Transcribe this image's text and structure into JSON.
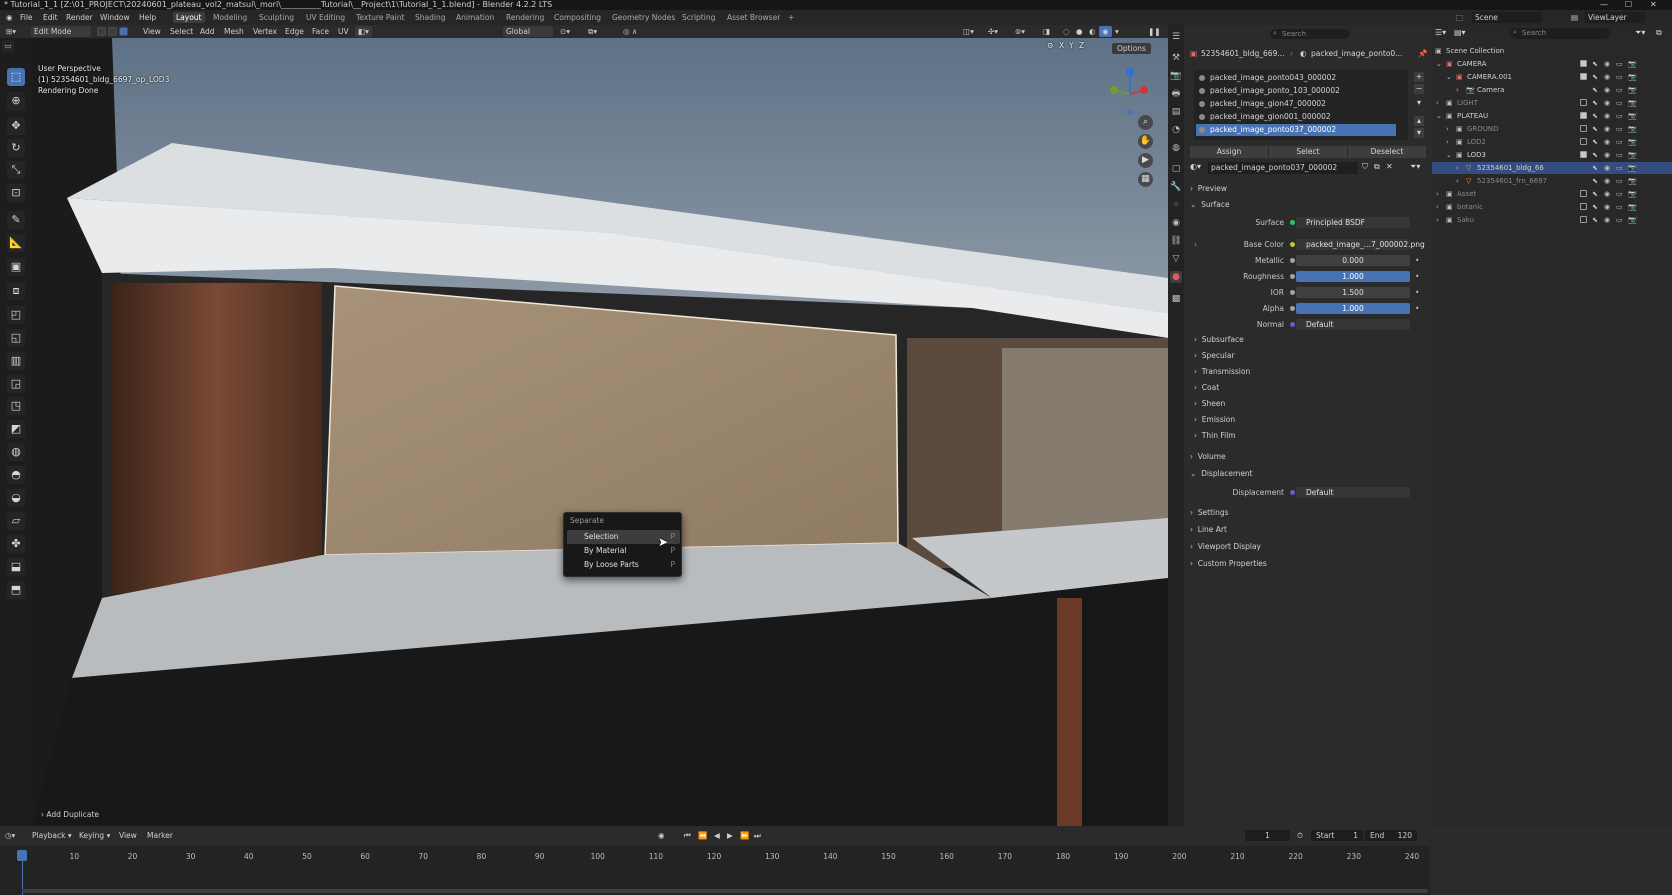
{
  "title_bar": {
    "text": "* Tutorial_1_1 [Z:\\01_PROJECT\\20240601_plateau_vol2_matsui\\_mori\\__________Tutorial\\__Project\\1\\Tutorial_1_1.blend] - Blender 4.2.2 LTS"
  },
  "menu": {
    "items": [
      "File",
      "Edit",
      "Render",
      "Window",
      "Help"
    ]
  },
  "workspaces": [
    "Layout",
    "Modeling",
    "Sculpting",
    "UV Editing",
    "Texture Paint",
    "Shading",
    "Animation",
    "Rendering",
    "Compositing",
    "Geometry Nodes",
    "Scripting",
    "Asset Browser"
  ],
  "scene": {
    "name": "Scene",
    "view_layer": "ViewLayer",
    "search_placeholder": "Search"
  },
  "viewport_header": {
    "mode": "Edit Mode",
    "menus": [
      "View",
      "Select",
      "Add",
      "Mesh",
      "Vertex",
      "Edge",
      "Face",
      "UV"
    ],
    "orientation": "Global",
    "options_label": "Options",
    "axes": [
      "X",
      "Y",
      "Z"
    ]
  },
  "viewport": {
    "overlay_line1": "User Perspective",
    "overlay_line2": "(1) 52354601_bldg_6697_op_LOD3",
    "overlay_line3": "Rendering Done",
    "operator_panel": "Add Duplicate"
  },
  "context_menu": {
    "title": "Separate",
    "items": [
      {
        "label": "Selection",
        "shortcut": "P"
      },
      {
        "label": "By Material",
        "shortcut": "P"
      },
      {
        "label": "By Loose Parts",
        "shortcut": "P"
      }
    ]
  },
  "properties": {
    "breadcrumb": [
      "52354601_bldg_669...",
      "packed_image_ponto0..."
    ],
    "material_slots": [
      "packed_image_ponto043_000002",
      "packed_image_ponto_103_000002",
      "packed_image_gion47_000002",
      "packed_image_gion001_000002",
      "packed_image_ponto037_000002"
    ],
    "slot_buttons": {
      "assign": "Assign",
      "select": "Select",
      "deselect": "Deselect"
    },
    "material_name": "packed_image_ponto037_000002",
    "sections": {
      "preview": "Preview",
      "surface": "Surface",
      "volume": "Volume",
      "displacement": "Displacement",
      "settings": "Settings",
      "line_art": "Line Art",
      "viewport_display": "Viewport Display",
      "custom_properties": "Custom Properties"
    },
    "surface_fields": [
      {
        "label": "Surface",
        "value": "Principled BSDF"
      },
      {
        "label": "Base Color",
        "value": "packed_image_...7_000002.png"
      },
      {
        "label": "Metallic",
        "value": "0.000"
      },
      {
        "label": "Roughness",
        "value": "1.000"
      },
      {
        "label": "IOR",
        "value": "1.500"
      },
      {
        "label": "Alpha",
        "value": "1.000"
      },
      {
        "label": "Normal",
        "value": "Default"
      }
    ],
    "subpanels": [
      "Subsurface",
      "Specular",
      "Transmission",
      "Coat",
      "Sheen",
      "Emission",
      "Thin Film"
    ],
    "displacement_field": {
      "label": "Displacement",
      "value": "Default"
    }
  },
  "outliner": {
    "root": "Scene Collection",
    "rows": [
      {
        "label": "CAMERA",
        "indent": 1
      },
      {
        "label": "CAMERA.001",
        "indent": 2
      },
      {
        "label": "Camera",
        "indent": 3
      },
      {
        "label": "LIGHT",
        "indent": 1
      },
      {
        "label": "PLATEAU",
        "indent": 1
      },
      {
        "label": "GROUND",
        "indent": 2
      },
      {
        "label": "LOD2",
        "indent": 2
      },
      {
        "label": "LOD3",
        "indent": 2
      },
      {
        "label": "52354601_bldg_66",
        "indent": 3
      },
      {
        "label": "52354601_frn_6697",
        "indent": 3
      },
      {
        "label": "Asset",
        "indent": 1
      },
      {
        "label": "botanic",
        "indent": 1
      },
      {
        "label": "Saku",
        "indent": 1
      }
    ]
  },
  "timeline": {
    "menus": [
      "Playback",
      "Keying",
      "View",
      "Marker"
    ],
    "current_frame": "1",
    "start_label": "Start",
    "start": "1",
    "end_label": "End",
    "end": "120",
    "ticks": [
      "1",
      "10",
      "20",
      "30",
      "40",
      "50",
      "60",
      "70",
      "80",
      "90",
      "100",
      "110",
      "120",
      "130",
      "140",
      "150",
      "160",
      "170",
      "180",
      "190",
      "200",
      "210",
      "220",
      "230",
      "240"
    ]
  },
  "colors": {
    "accent": "#4772b3",
    "panel": "#2b2b2b",
    "header": "#262626"
  }
}
